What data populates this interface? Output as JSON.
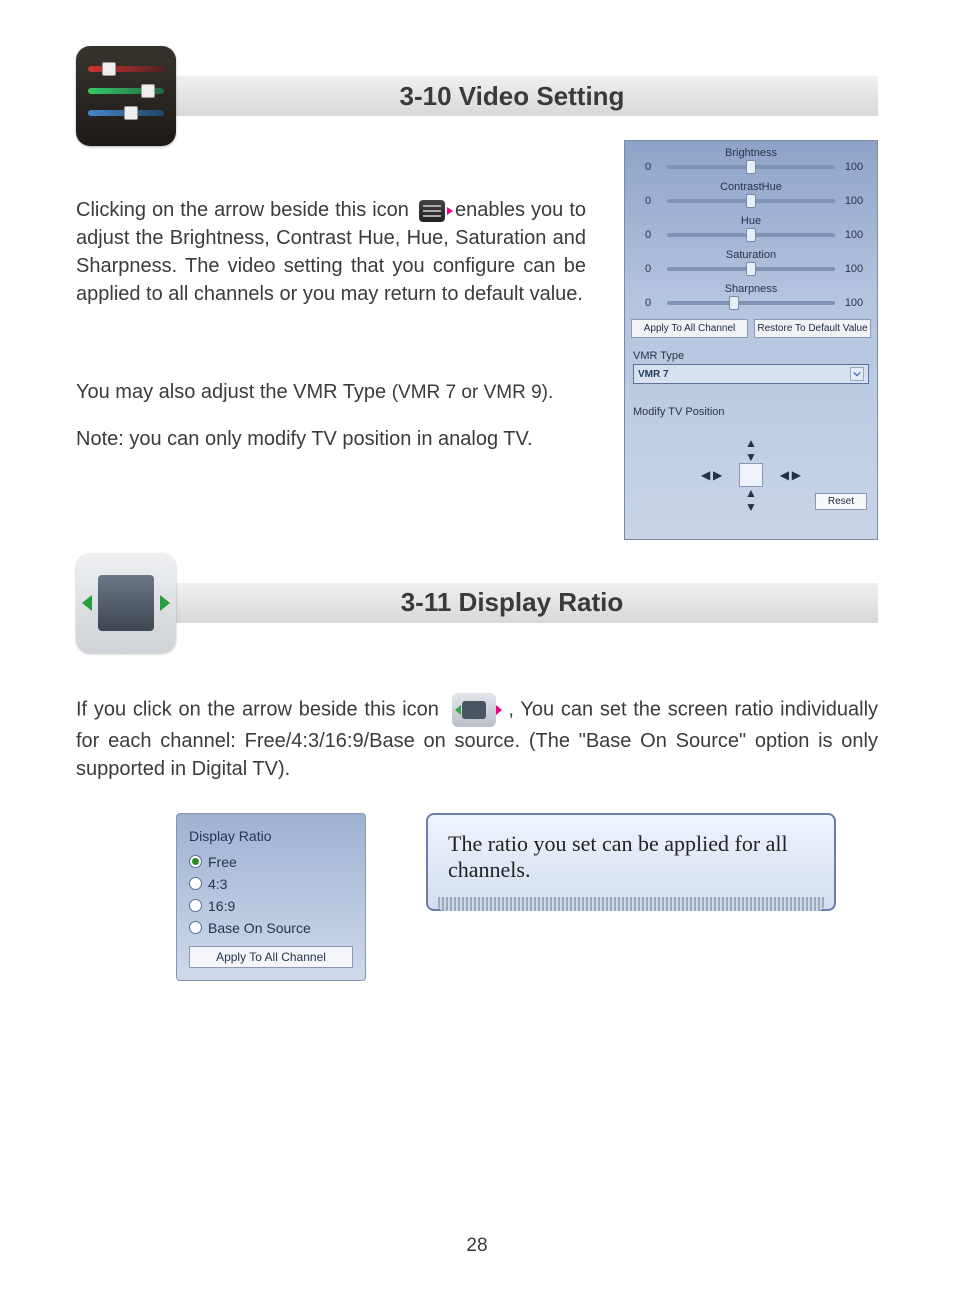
{
  "section1": {
    "heading": "3-10 Video Setting",
    "p1a": "Clicking on the arrow beside this icon ",
    "p1b": " enables you to adjust the Brightness, Contrast Hue, Hue, Saturation and Sharpness. The video setting that you configure can be applied to all channels or you may return to default value.",
    "p2a": "You may also adjust the VMR Type ",
    "p2b": "(VMR 7 or VMR 9).",
    "p3": "Note: you can only modify TV position in analog TV."
  },
  "video_panel": {
    "sliders": [
      {
        "label": "Brightness",
        "min": "0",
        "max": "100",
        "pos": 50
      },
      {
        "label": "ContrastHue",
        "min": "0",
        "max": "100",
        "pos": 50
      },
      {
        "label": "Hue",
        "min": "0",
        "max": "100",
        "pos": 50
      },
      {
        "label": "Saturation",
        "min": "0",
        "max": "100",
        "pos": 50
      },
      {
        "label": "Sharpness",
        "min": "0",
        "max": "100",
        "pos": 40
      }
    ],
    "apply_btn": "Apply To All Channel",
    "restore_btn": "Restore To Default Value",
    "vmr_label": "VMR Type",
    "vmr_value": "VMR 7",
    "modify_label": "Modify TV Position",
    "reset": "Reset"
  },
  "section2": {
    "heading": "3-11 Display Ratio",
    "p1a": "If you click on the arrow beside this icon ",
    "p1b": ", You can set the screen ratio individually for each channel: Free/4:3/16:9/Base on source. (The \"Base On Source\" option is only supported in Digital TV)."
  },
  "ratio_panel": {
    "title": "Display Ratio",
    "options": [
      {
        "label": "Free",
        "selected": true
      },
      {
        "label": "4:3",
        "selected": false
      },
      {
        "label": "16:9",
        "selected": false
      },
      {
        "label": "Base On Source",
        "selected": false
      }
    ],
    "apply": "Apply To All Channel"
  },
  "callout": "The ratio you set can be applied for all channels.",
  "page": "28"
}
